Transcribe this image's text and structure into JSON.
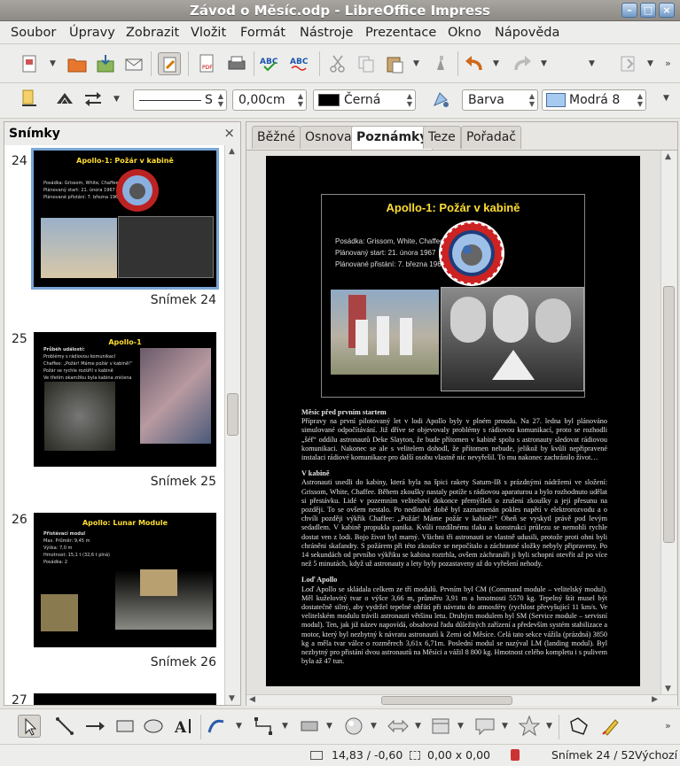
{
  "window": {
    "title": "Závod o Měsíc.odp - LibreOffice Impress"
  },
  "menu": [
    "Soubor",
    "Úpravy",
    "Zobrazit",
    "Vložit",
    "Formát",
    "Nástroje",
    "Prezentace",
    "Okno",
    "Nápověda"
  ],
  "line_toolbar": {
    "line_style": "S",
    "line_width": "0,00cm",
    "line_color": "Černá",
    "area_type": "Barva",
    "area_color": "Modrá 8",
    "area_color_hex": "#a6caf0"
  },
  "slides_pane": {
    "title": "Snímky",
    "slides": [
      {
        "number": "24",
        "caption": "Snímek 24",
        "title": "Apollo-1: Požár v kabině",
        "selected": true,
        "lines": [
          "Posádka: Grissom, White, Chaffee",
          "Plánovaný start: 21. února 1967",
          "Plánované přistání: 7. března 1967"
        ]
      },
      {
        "number": "25",
        "caption": "Snímek 25",
        "title": "Apollo-1",
        "lines": [
          "Průběh událostí:",
          "Problémy s rádiovou komunikací",
          "Chaffee: „Požár! Máme požár v kabině!“",
          "Požár se rychle rozšířil v kabině",
          "Ve třetím okamžiku byla kabina zničena"
        ]
      },
      {
        "number": "26",
        "caption": "Snímek 26",
        "title": "Apollo: Lunar Module",
        "lines": [
          "Přistávací modul",
          "Max. Průměr: 9,45 m",
          "Výška: 7,0 m",
          "Hmotnost: 15,1 t (32,6 t plná)",
          "Posádka: 2"
        ]
      },
      {
        "number": "27"
      }
    ]
  },
  "tabs": [
    "Běžné",
    "Osnova",
    "Poznámky",
    "Teze",
    "Pořadač snímků"
  ],
  "active_tab": "Poznámky",
  "notes_view": {
    "slide_title": "Apollo-1: Požár v kabině",
    "slide_lines": [
      "Posádka: Grissom, White, Chaffee",
      "Plánovaný start: 21. února 1967",
      "Plánované přistání: 7. března 1967"
    ],
    "sections": [
      {
        "heading": "Měsíc před prvním startem",
        "text": "Přípravy na první pilotovaný let v lodi Apollo byly v plném proudu. Na 27. ledna byl plánováno simulované odpočítávání. Již dříve se objevovaly problémy s rádiovou komunikací, proto se rozhodli „šéf“ oddílu astronautů Deke Slayton, že bude přítomen v kabině spolu s astronauty sledovat rádiovou komunikaci. Nakonec se ale s velitelem dohodl, že přítomen nebude, jelikož by kvůli nepřipravené instalaci rádiové komunikace pro další osobu vlastně nic nevyřešil. To mu nakonec zachránilo život…"
      },
      {
        "heading": "V kabině",
        "text": "Astronauti usedli do kabiny, která byla na špici rakety Saturn-IB s prázdnými nádržemi ve složení: Grissom, White, Chaffee. Během zkoušky nastaly potíže s rádiovou aparaturou a bylo rozhodnuto udělat si přestávku. Lidé v pozemním velitelství dokonce přemýšleli o zrušení zkoušky a její přesunu na později. To se ovšem nestalo. Po nedlouhé době byl zaznamenán pokles napětí v elektrorozvodu a o chvíli později výkřik Chaffee: „Požár! Máme požár v kabině!“ Oheň se vyskytl právě pod levým sedadlem. V kabině propukla panika. Kvůli rozdílnému tlaku a konstrukci průlezu se nemohli rychle dostat ven z lodi. Bojo život byl marný. Všichni tři astronauti se vlastně udusili, protože proti ohni byli chráněni skafandry. S požárem při této zkoušce se nepočítalo a záchranné složky nebyly připraveny. Po 14 sekundách od prvního výkřiku se kabina roztrhla, ovšem záchranáři ji byli schopni otevřít až po více než 5 minutách, když už astronauty a lety byly pozastaveny až do vyřešení nehody."
      },
      {
        "heading": "Loď Apollo",
        "text": "Loď Apollo se skládala celkem ze tří modulů. Prvním byl CM (Command module – velitelský modul). Měl kuželovitý tvar o výšce 3,66 m, průměru 3,91 m a hmotnosti 5570 kg. Tepelný štít musel být dostatečně silný, aby vydržel tepelné ohřátí při návratu do atmosféry (rychlost převyšující 11 km/s. Ve velitelském modulu trávili astronauti většinu letu. Druhým modulem byl SM (Service module – servisní modul). Ten, jak již název napovídá, obsahoval řadu důležitých zařízení a především systém stabilizace a motor, který byl nezbytný k návratu astronautů k Zemi od Měsíce. Celá tato sekce vážila (prázdná) 3850 kg a měla tvar válce o rozměrech 3,61x 6,71m. Poslední modul se nazýval LM (landing modul). Byl nezbytný pro přistání dvou astronautů na Měsíci a vážil 8 800 kg. Hmotnost celého kompletu i s pulivem byla až 47 tun."
      }
    ]
  },
  "statusbar": {
    "position": "14,83 / -0,60",
    "size": "0,00 x 0,00",
    "slide": "Snímek 24 / 52",
    "layout": "Výchozí"
  }
}
